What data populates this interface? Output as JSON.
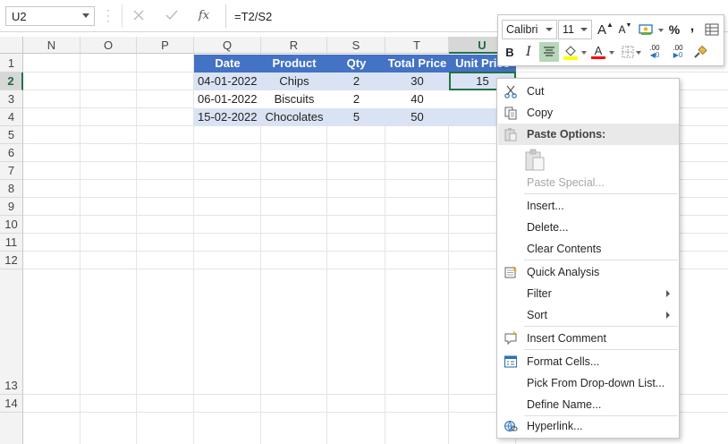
{
  "formula_bar": {
    "name_box": "U2",
    "fx_label": "fx",
    "formula": "=T2/S2"
  },
  "columns": [
    "N",
    "O",
    "P",
    "Q",
    "R",
    "S",
    "T",
    "U"
  ],
  "selected_column": "U",
  "rows": [
    "1",
    "2",
    "3",
    "4",
    "5",
    "6",
    "7",
    "8",
    "9",
    "10",
    "11",
    "12",
    "13",
    "14"
  ],
  "selected_row": "2",
  "table": {
    "headers": [
      "Date",
      "Product",
      "Qty",
      "Total Price",
      "Unit Price"
    ],
    "rows": [
      [
        "04-01-2022",
        "Chips",
        "2",
        "30",
        "15"
      ],
      [
        "06-01-2022",
        "Biscuits",
        "2",
        "40",
        ""
      ],
      [
        "15-02-2022",
        "Chocolates",
        "5",
        "50",
        ""
      ]
    ]
  },
  "mini_toolbar": {
    "font_name": "Calibri",
    "font_size": "11",
    "grow_label": "A",
    "shrink_label": "A",
    "percent_label": "%",
    "comma_label": ",",
    "bold_label": "B",
    "italic_label": "I",
    "font_color_label": "A",
    "inc_decimal_label": ".00",
    "dec_decimal_label": ".00",
    "fill_color": "#ffff00",
    "font_color": "#ff0000"
  },
  "context_menu": {
    "cut": "Cut",
    "copy": "Copy",
    "paste_options": "Paste Options:",
    "paste_special": "Paste Special...",
    "insert": "Insert...",
    "delete": "Delete...",
    "clear_contents": "Clear Contents",
    "quick_analysis": "Quick Analysis",
    "filter": "Filter",
    "sort": "Sort",
    "insert_comment": "Insert Comment",
    "format_cells": "Format Cells...",
    "pick_list": "Pick From Drop-down List...",
    "define_name": "Define Name...",
    "hyperlink": "Hyperlink..."
  },
  "colors": {
    "table_header": "#4472c4",
    "band": "#dae3f3",
    "selection": "#217346"
  }
}
